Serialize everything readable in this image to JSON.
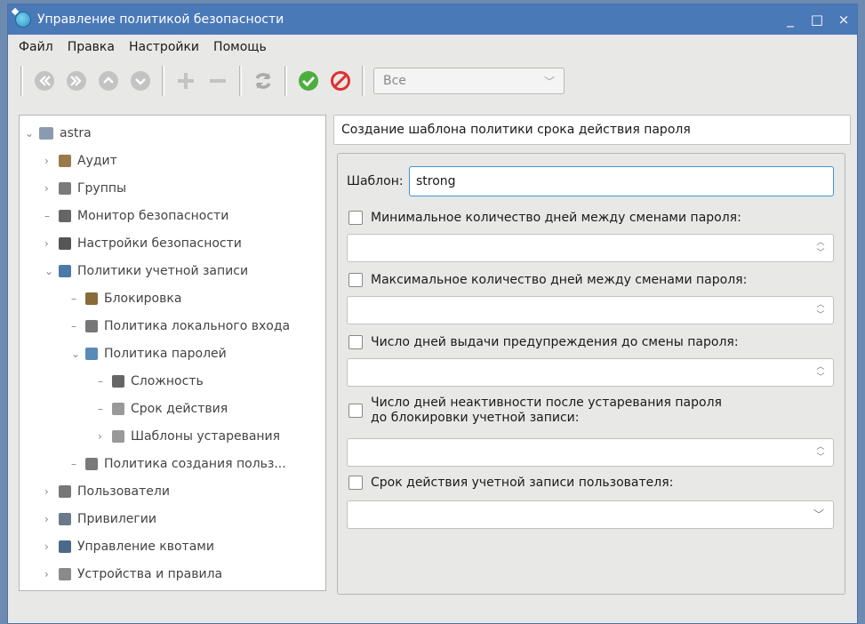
{
  "window": {
    "title": "Управление политикой безопасности",
    "controls": [
      "_",
      "□",
      "×"
    ]
  },
  "menu": [
    "Файл",
    "Правка",
    "Настройки",
    "Помощь"
  ],
  "toolbar": {
    "icons": [
      "first-icon",
      "last-icon",
      "up-icon",
      "down-icon",
      "add-icon",
      "remove-icon",
      "refresh-icon",
      "apply-icon",
      "cancel-icon"
    ],
    "filter": {
      "value": "Все"
    }
  },
  "tree": {
    "root": "astra",
    "items": [
      {
        "label": "Аудит",
        "level": 1,
        "expander": ">",
        "color": "#9a7a4a"
      },
      {
        "label": "Группы",
        "level": 1,
        "expander": ">",
        "color": "#7a7a7a"
      },
      {
        "label": "Монитор безопасности",
        "level": 1,
        "expander": "",
        "color": "#666"
      },
      {
        "label": "Настройки безопасности",
        "level": 1,
        "expander": ">",
        "color": "#555"
      },
      {
        "label": "Политики учетной записи",
        "level": 1,
        "expander": "v",
        "color": "#4a7aa8"
      },
      {
        "label": "Блокировка",
        "level": 2,
        "expander": "",
        "color": "#8a6a3a"
      },
      {
        "label": "Политика локального входа",
        "level": 2,
        "expander": "",
        "color": "#777"
      },
      {
        "label": "Политика паролей",
        "level": 2,
        "expander": "v",
        "color": "#5a8ab8"
      },
      {
        "label": "Сложность",
        "level": 3,
        "expander": "",
        "color": "#666"
      },
      {
        "label": "Срок действия",
        "level": 3,
        "expander": "",
        "color": "#999"
      },
      {
        "label": "Шаблоны устаревания",
        "level": 3,
        "expander": ">",
        "color": "#999"
      },
      {
        "label": "Политика создания польз...",
        "level": 2,
        "expander": "",
        "color": "#7a7a7a"
      },
      {
        "label": "Пользователи",
        "level": 1,
        "expander": ">",
        "color": "#777"
      },
      {
        "label": "Привилегии",
        "level": 1,
        "expander": ">",
        "color": "#6a7a8a"
      },
      {
        "label": "Управление квотами",
        "level": 1,
        "expander": ">",
        "color": "#4a6a8a"
      },
      {
        "label": "Устройства и правила",
        "level": 1,
        "expander": ">",
        "color": "#8a8a8a"
      }
    ]
  },
  "form": {
    "heading": "Создание шаблона политики срока действия пароля",
    "template_label": "Шаблон:",
    "template_value": "strong",
    "fields": [
      {
        "label": "Минимальное количество дней между сменами пароля:",
        "checked": false,
        "kind": "spin"
      },
      {
        "label": "Максимальное количество дней между сменами пароля:",
        "checked": false,
        "kind": "spin"
      },
      {
        "label": "Число дней выдачи предупреждения до смены пароля:",
        "checked": false,
        "kind": "spin"
      },
      {
        "label": "Число дней неактивности после устаревания пароля\nдо блокировки учетной записи:",
        "checked": false,
        "kind": "spin"
      },
      {
        "label": "Срок действия учетной записи пользователя:",
        "checked": false,
        "kind": "dropdown"
      }
    ]
  }
}
